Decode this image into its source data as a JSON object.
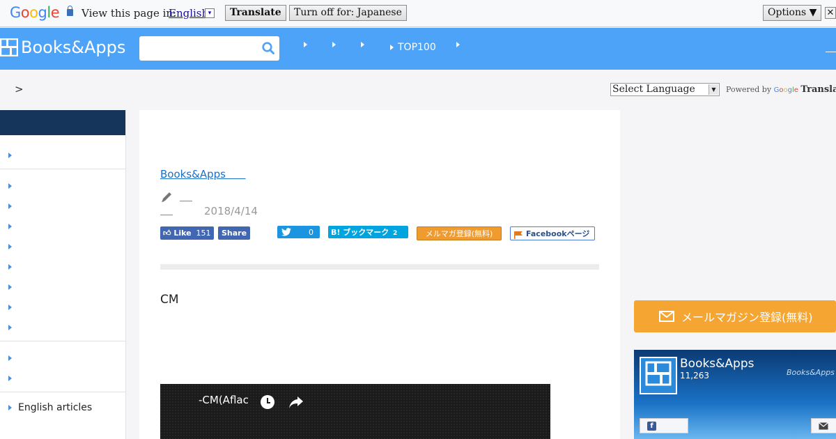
{
  "translate_bar": {
    "logo": [
      "G",
      "o",
      "o",
      "g",
      "l",
      "e"
    ],
    "prompt": "View this page in:",
    "language": "English",
    "dropdown_glyph": "▾",
    "translate_label": "Translate",
    "turn_off_label": "Turn off for: Japanese",
    "options_label": "Options ▼",
    "close_glyph": "✕"
  },
  "header": {
    "logo_text": "Books&Apps",
    "search_placeholder": "",
    "nav": [
      "",
      "",
      "",
      "TOP100",
      ""
    ]
  },
  "breadcrumb": {
    "separator": ">"
  },
  "translate_widget": {
    "select_label": "Select Language",
    "arrow": "▼",
    "powered_by": "Powered by",
    "google": "Google",
    "translate": "Translate"
  },
  "sidebar": {
    "bottom_item": "English articles"
  },
  "article": {
    "category_link": "Books&Apps",
    "date": "2018/4/14",
    "share": {
      "fb_like": "Like",
      "fb_count": "151",
      "fb_share": "Share",
      "tw_count": "0",
      "hatena": "B! ブックマーク",
      "hatena_count": "2",
      "mailmag": "メルマガ登録(無料)",
      "facebook_page": "Facebookページ"
    },
    "body_text": "CM",
    "video_title": "-CM(Aflac"
  },
  "right": {
    "mail_button": "メールマガジン登録(無料)",
    "fb_page_name": "Books&Apps",
    "fb_page_count": "11,263",
    "fb_watermark": "Books&Apps"
  },
  "colors": {
    "header_blue": "#4da3f7",
    "sidebar_navy": "#16355a",
    "accent_orange": "#f5a532"
  }
}
